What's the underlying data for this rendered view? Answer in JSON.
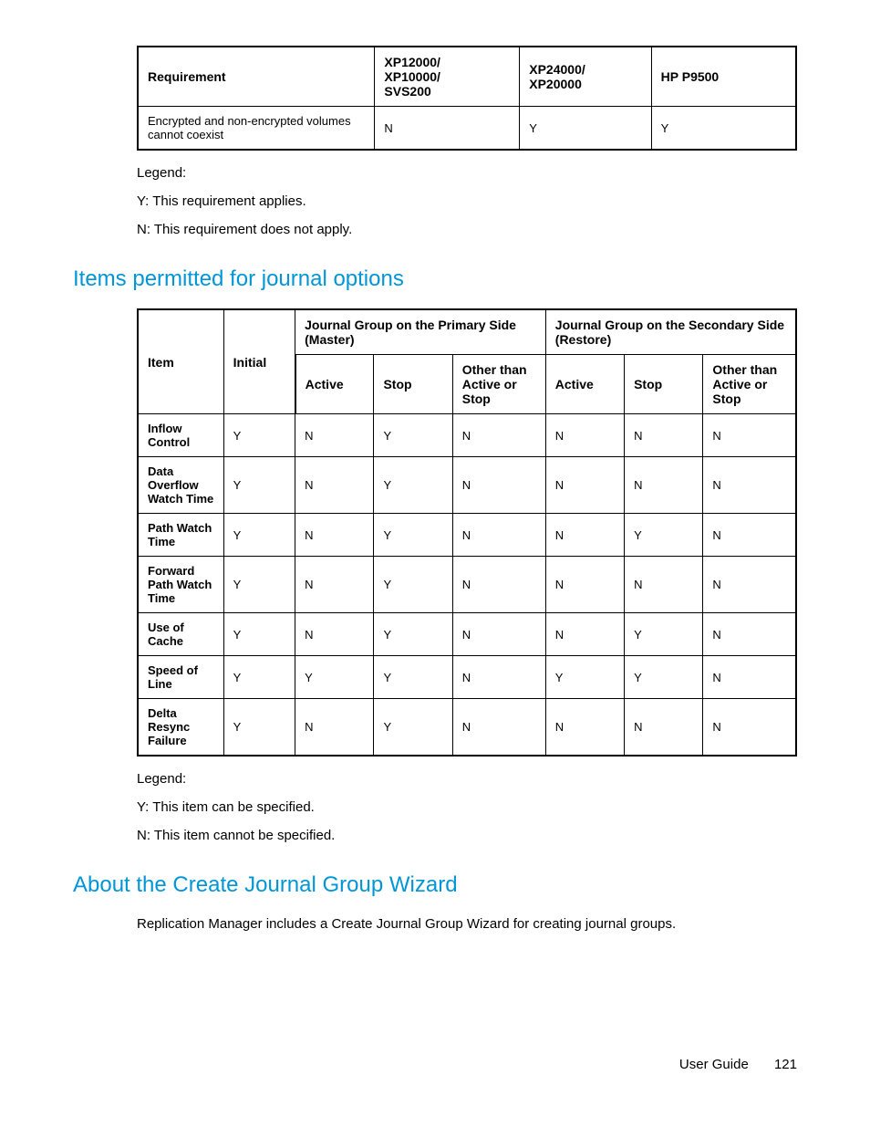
{
  "table1": {
    "headers": [
      "Requirement",
      "XP12000/\nXP10000/\nSVS200",
      "XP24000/\nXP20000",
      "HP P9500"
    ],
    "row": {
      "label": "Encrypted and non-encrypted volumes cannot coexist",
      "c1": "N",
      "c2": "Y",
      "c3": "Y"
    }
  },
  "legend1": {
    "title": "Legend:",
    "y": "Y: This requirement applies.",
    "n": "N: This requirement does not apply."
  },
  "heading1": "Items permitted for journal options",
  "table2": {
    "head": {
      "item": "Item",
      "initial": "Initial",
      "primary": "Journal Group on the Primary Side (Master)",
      "secondary": "Journal Group on the Secondary Side\n(Restore)",
      "active": "Active",
      "stop": "Stop",
      "other": "Other than Active or Stop"
    },
    "rows": [
      {
        "label": "Inflow Control",
        "cells": [
          "Y",
          "N",
          "Y",
          "N",
          "N",
          "N",
          "N"
        ]
      },
      {
        "label": "Data Overflow Watch Time",
        "cells": [
          "Y",
          "N",
          "Y",
          "N",
          "N",
          "N",
          "N"
        ]
      },
      {
        "label": "Path Watch Time",
        "cells": [
          "Y",
          "N",
          "Y",
          "N",
          "N",
          "Y",
          "N"
        ]
      },
      {
        "label": "Forward Path Watch Time",
        "cells": [
          "Y",
          "N",
          "Y",
          "N",
          "N",
          "N",
          "N"
        ]
      },
      {
        "label": "Use of Cache",
        "cells": [
          "Y",
          "N",
          "Y",
          "N",
          "N",
          "Y",
          "N"
        ]
      },
      {
        "label": "Speed of Line",
        "cells": [
          "Y",
          "Y",
          "Y",
          "N",
          "Y",
          "Y",
          "N"
        ]
      },
      {
        "label": "Delta Resync Failure",
        "cells": [
          "Y",
          "N",
          "Y",
          "N",
          "N",
          "N",
          "N"
        ]
      }
    ]
  },
  "legend2": {
    "title": "Legend:",
    "y": "Y: This item can be specified.",
    "n": "N: This item cannot be specified."
  },
  "heading2": "About the Create Journal Group Wizard",
  "para2": "Replication Manager includes a Create Journal Group Wizard for creating journal groups.",
  "footer": {
    "label": "User Guide",
    "page": "121"
  }
}
